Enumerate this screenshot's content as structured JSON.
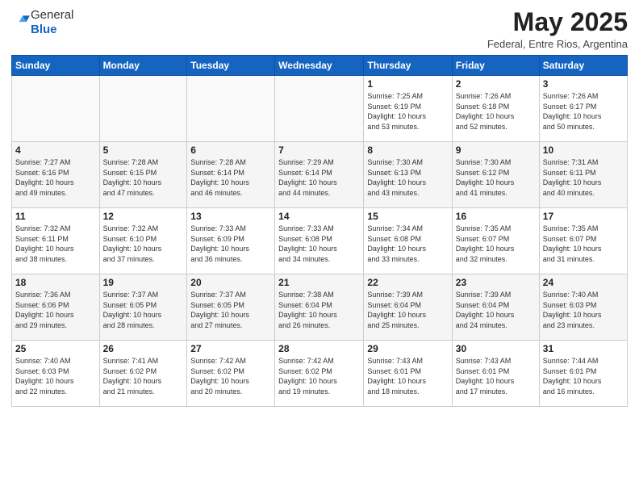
{
  "header": {
    "logo_general": "General",
    "logo_blue": "Blue",
    "month_title": "May 2025",
    "subtitle": "Federal, Entre Rios, Argentina"
  },
  "weekdays": [
    "Sunday",
    "Monday",
    "Tuesday",
    "Wednesday",
    "Thursday",
    "Friday",
    "Saturday"
  ],
  "weeks": [
    [
      {
        "day": "",
        "info": ""
      },
      {
        "day": "",
        "info": ""
      },
      {
        "day": "",
        "info": ""
      },
      {
        "day": "",
        "info": ""
      },
      {
        "day": "1",
        "info": "Sunrise: 7:25 AM\nSunset: 6:19 PM\nDaylight: 10 hours\nand 53 minutes."
      },
      {
        "day": "2",
        "info": "Sunrise: 7:26 AM\nSunset: 6:18 PM\nDaylight: 10 hours\nand 52 minutes."
      },
      {
        "day": "3",
        "info": "Sunrise: 7:26 AM\nSunset: 6:17 PM\nDaylight: 10 hours\nand 50 minutes."
      }
    ],
    [
      {
        "day": "4",
        "info": "Sunrise: 7:27 AM\nSunset: 6:16 PM\nDaylight: 10 hours\nand 49 minutes."
      },
      {
        "day": "5",
        "info": "Sunrise: 7:28 AM\nSunset: 6:15 PM\nDaylight: 10 hours\nand 47 minutes."
      },
      {
        "day": "6",
        "info": "Sunrise: 7:28 AM\nSunset: 6:14 PM\nDaylight: 10 hours\nand 46 minutes."
      },
      {
        "day": "7",
        "info": "Sunrise: 7:29 AM\nSunset: 6:14 PM\nDaylight: 10 hours\nand 44 minutes."
      },
      {
        "day": "8",
        "info": "Sunrise: 7:30 AM\nSunset: 6:13 PM\nDaylight: 10 hours\nand 43 minutes."
      },
      {
        "day": "9",
        "info": "Sunrise: 7:30 AM\nSunset: 6:12 PM\nDaylight: 10 hours\nand 41 minutes."
      },
      {
        "day": "10",
        "info": "Sunrise: 7:31 AM\nSunset: 6:11 PM\nDaylight: 10 hours\nand 40 minutes."
      }
    ],
    [
      {
        "day": "11",
        "info": "Sunrise: 7:32 AM\nSunset: 6:11 PM\nDaylight: 10 hours\nand 38 minutes."
      },
      {
        "day": "12",
        "info": "Sunrise: 7:32 AM\nSunset: 6:10 PM\nDaylight: 10 hours\nand 37 minutes."
      },
      {
        "day": "13",
        "info": "Sunrise: 7:33 AM\nSunset: 6:09 PM\nDaylight: 10 hours\nand 36 minutes."
      },
      {
        "day": "14",
        "info": "Sunrise: 7:33 AM\nSunset: 6:08 PM\nDaylight: 10 hours\nand 34 minutes."
      },
      {
        "day": "15",
        "info": "Sunrise: 7:34 AM\nSunset: 6:08 PM\nDaylight: 10 hours\nand 33 minutes."
      },
      {
        "day": "16",
        "info": "Sunrise: 7:35 AM\nSunset: 6:07 PM\nDaylight: 10 hours\nand 32 minutes."
      },
      {
        "day": "17",
        "info": "Sunrise: 7:35 AM\nSunset: 6:07 PM\nDaylight: 10 hours\nand 31 minutes."
      }
    ],
    [
      {
        "day": "18",
        "info": "Sunrise: 7:36 AM\nSunset: 6:06 PM\nDaylight: 10 hours\nand 29 minutes."
      },
      {
        "day": "19",
        "info": "Sunrise: 7:37 AM\nSunset: 6:05 PM\nDaylight: 10 hours\nand 28 minutes."
      },
      {
        "day": "20",
        "info": "Sunrise: 7:37 AM\nSunset: 6:05 PM\nDaylight: 10 hours\nand 27 minutes."
      },
      {
        "day": "21",
        "info": "Sunrise: 7:38 AM\nSunset: 6:04 PM\nDaylight: 10 hours\nand 26 minutes."
      },
      {
        "day": "22",
        "info": "Sunrise: 7:39 AM\nSunset: 6:04 PM\nDaylight: 10 hours\nand 25 minutes."
      },
      {
        "day": "23",
        "info": "Sunrise: 7:39 AM\nSunset: 6:04 PM\nDaylight: 10 hours\nand 24 minutes."
      },
      {
        "day": "24",
        "info": "Sunrise: 7:40 AM\nSunset: 6:03 PM\nDaylight: 10 hours\nand 23 minutes."
      }
    ],
    [
      {
        "day": "25",
        "info": "Sunrise: 7:40 AM\nSunset: 6:03 PM\nDaylight: 10 hours\nand 22 minutes."
      },
      {
        "day": "26",
        "info": "Sunrise: 7:41 AM\nSunset: 6:02 PM\nDaylight: 10 hours\nand 21 minutes."
      },
      {
        "day": "27",
        "info": "Sunrise: 7:42 AM\nSunset: 6:02 PM\nDaylight: 10 hours\nand 20 minutes."
      },
      {
        "day": "28",
        "info": "Sunrise: 7:42 AM\nSunset: 6:02 PM\nDaylight: 10 hours\nand 19 minutes."
      },
      {
        "day": "29",
        "info": "Sunrise: 7:43 AM\nSunset: 6:01 PM\nDaylight: 10 hours\nand 18 minutes."
      },
      {
        "day": "30",
        "info": "Sunrise: 7:43 AM\nSunset: 6:01 PM\nDaylight: 10 hours\nand 17 minutes."
      },
      {
        "day": "31",
        "info": "Sunrise: 7:44 AM\nSunset: 6:01 PM\nDaylight: 10 hours\nand 16 minutes."
      }
    ]
  ]
}
